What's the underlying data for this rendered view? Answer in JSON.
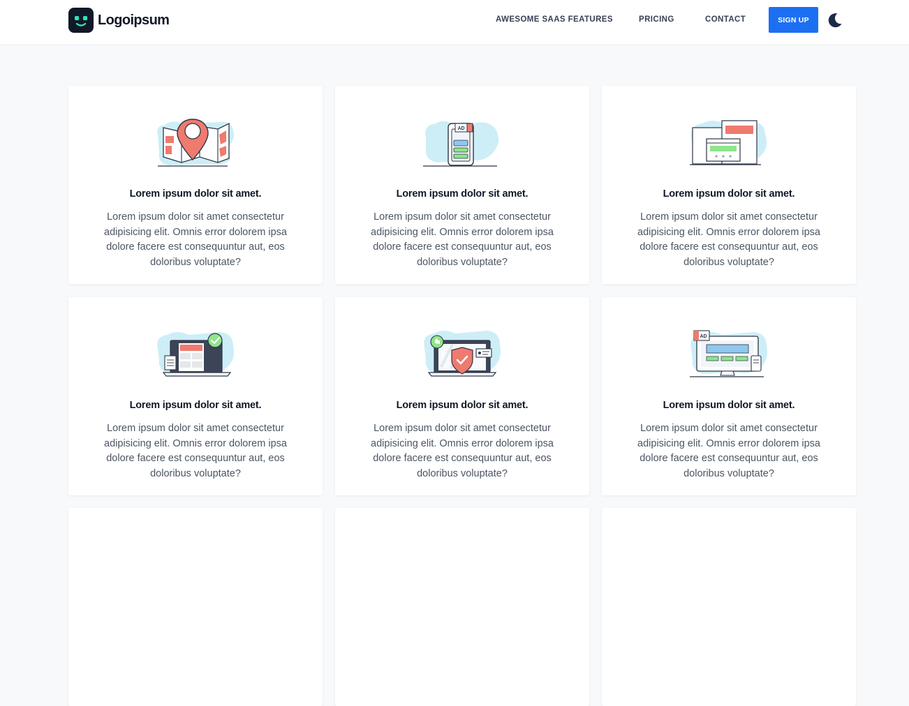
{
  "brand": {
    "name": "Logoipsum",
    "accent": "#1d6ff2",
    "logo_face_color": "#2ee6b4"
  },
  "nav": {
    "links": [
      "AWESOME SAAS FEATURES",
      "PRICING",
      "CONTACT"
    ],
    "signup_label": "SIGN UP",
    "theme_toggle_icon": "moon-icon"
  },
  "cards": [
    {
      "icon": "map-pin-illustration",
      "title": "Lorem ipsum dolor sit amet.",
      "text": "Lorem ipsum dolor sit amet consectetur adipisicing elit. Omnis error dolorem ipsa dolore facere est consequuntur aut, eos doloribus voluptate?"
    },
    {
      "icon": "phone-ad-illustration",
      "title": "Lorem ipsum dolor sit amet.",
      "text": "Lorem ipsum dolor sit amet consectetur adipisicing elit. Omnis error dolorem ipsa dolore facere est consequuntur aut, eos doloribus voluptate?"
    },
    {
      "icon": "browser-windows-illustration",
      "title": "Lorem ipsum dolor sit amet.",
      "text": "Lorem ipsum dolor sit amet consectetur adipisicing elit. Omnis error dolorem ipsa dolore facere est consequuntur aut, eos doloribus voluptate?"
    },
    {
      "icon": "laptop-check-illustration",
      "title": "Lorem ipsum dolor sit amet.",
      "text": "Lorem ipsum dolor sit amet consectetur adipisicing elit. Omnis error dolorem ipsa dolore facere est consequuntur aut, eos doloribus voluptate?"
    },
    {
      "icon": "laptop-shield-illustration",
      "title": "Lorem ipsum dolor sit amet.",
      "text": "Lorem ipsum dolor sit amet consectetur adipisicing elit. Omnis error dolorem ipsa dolore facere est consequuntur aut, eos doloribus voluptate?"
    },
    {
      "icon": "monitor-ad-illustration",
      "title": "Lorem ipsum dolor sit amet.",
      "text": "Lorem ipsum dolor sit amet consectetur adipisicing elit. Omnis error dolorem ipsa dolore facere est consequuntur aut, eos doloribus voluptate?"
    }
  ]
}
